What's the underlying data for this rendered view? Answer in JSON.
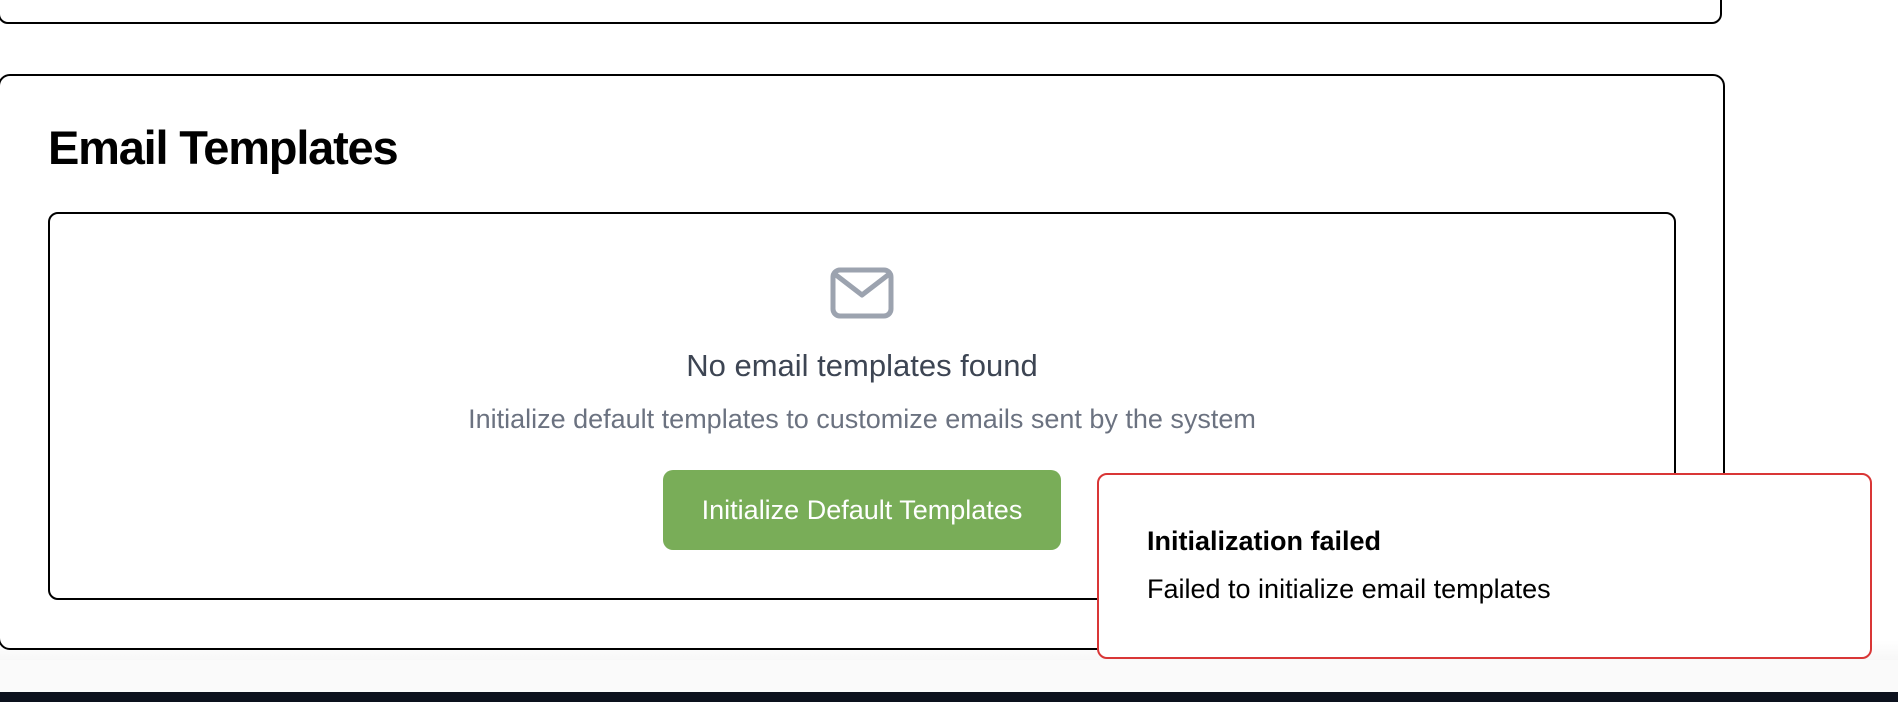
{
  "section": {
    "title": "Email Templates"
  },
  "empty_state": {
    "icon": "mail-icon",
    "title": "No email templates found",
    "description": "Initialize default templates to customize emails sent by the system",
    "button_label": "Initialize Default Templates"
  },
  "toast": {
    "title": "Initialization failed",
    "message": "Failed to initialize email templates"
  },
  "colors": {
    "primary_button": "#79ad58",
    "toast_border": "#d93636",
    "icon": "#9ca3af",
    "footer": "#0c111d"
  }
}
